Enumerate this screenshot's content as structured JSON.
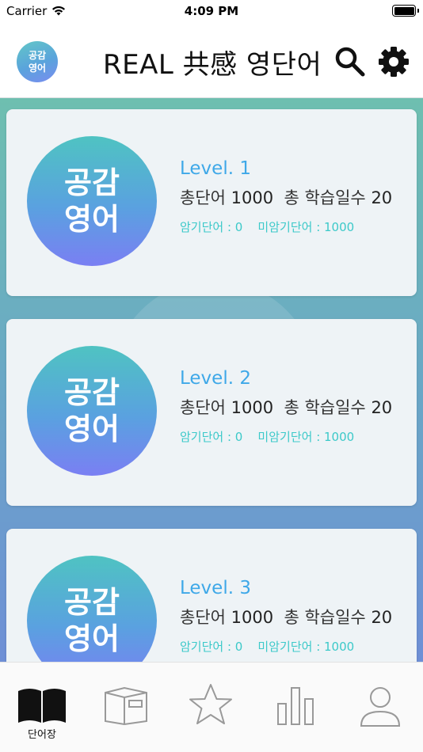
{
  "status": {
    "carrier": "Carrier",
    "time": "4:09 PM"
  },
  "header": {
    "title": "REAL 共感 영단어",
    "logo_text": "공감영어",
    "logo_small": "共感"
  },
  "cards": [
    {
      "level": "Level. 1",
      "total_label": "총단어",
      "total": "1000",
      "days_label": "총 학습일수",
      "days": "20",
      "memorized_label": "암기단어 : 0",
      "unmemorized_label": "미암기단어 : 1000"
    },
    {
      "level": "Level. 2",
      "total_label": "총단어",
      "total": "1000",
      "days_label": "총 학습일수",
      "days": "20",
      "memorized_label": "암기단어 : 0",
      "unmemorized_label": "미암기단어 : 1000"
    },
    {
      "level": "Level. 3",
      "total_label": "총단어",
      "total": "1000",
      "days_label": "총 학습일수",
      "days": "20",
      "memorized_label": "암기단어 : 0",
      "unmemorized_label": "미암기단어 : 1000"
    }
  ],
  "tabbar": {
    "items": [
      {
        "label": "단어장",
        "icon": "open-book-icon",
        "active": true
      },
      {
        "label": "",
        "icon": "study-book-icon",
        "active": false
      },
      {
        "label": "",
        "icon": "star-icon",
        "active": false
      },
      {
        "label": "",
        "icon": "bar-chart-icon",
        "active": false
      },
      {
        "label": "",
        "icon": "person-icon",
        "active": false
      }
    ]
  },
  "colors": {
    "accent": "#3ea8e8",
    "memo": "#3cc9c9",
    "gradient_top": "#6ebfb0",
    "gradient_bottom": "#6e8fd6"
  }
}
